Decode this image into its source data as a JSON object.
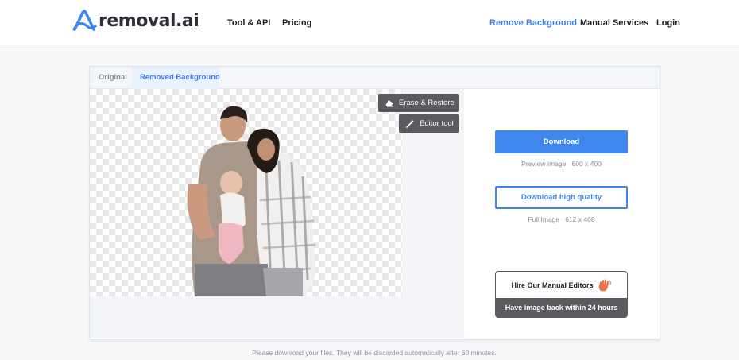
{
  "header": {
    "logo_text": "removal.ai",
    "nav": {
      "tool_api": "Tool & API",
      "pricing": "Pricing",
      "remove_background": "Remove Background",
      "manual_services": "Manual Services",
      "login": "Login"
    },
    "logo_icon": "removal-logo-icon"
  },
  "editor": {
    "tabs": {
      "original": "Original",
      "removed_background": "Removed Background"
    },
    "tools": {
      "erase_restore": "Erase & Restore",
      "editor_tool": "Editor tool"
    }
  },
  "sidebar": {
    "download_label": "Download",
    "preview_label": "Preview Image",
    "preview_size": "600 x 400",
    "hq_label": "Download high quality",
    "full_label": "Full Image",
    "full_size": "612 x 408",
    "manual_title": "Hire Our Manual Editors",
    "manual_subtitle": "Have image back within 24 hours"
  },
  "footer": {
    "note": "Please download your files. They will be discarded automatically after 60 minutes."
  },
  "colors": {
    "accent": "#3f86ee",
    "dark_button": "#5a5b5e",
    "tab_active_bg": "#e9f1fd"
  }
}
